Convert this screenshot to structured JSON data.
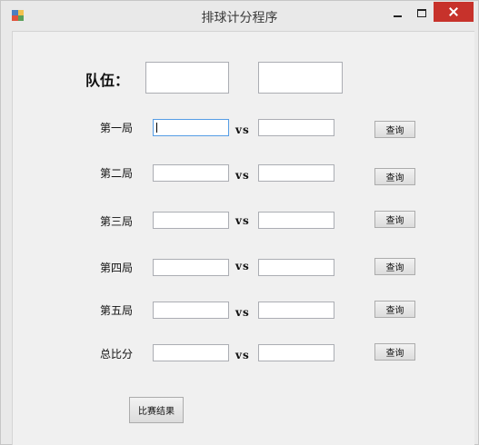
{
  "window": {
    "title": "排球计分程序"
  },
  "teams": {
    "label": "队伍：",
    "team_a": "",
    "team_b": ""
  },
  "rounds": [
    {
      "label": "第一局",
      "a": "",
      "b": "",
      "vs": "vs",
      "query": "查询"
    },
    {
      "label": "第二局",
      "a": "",
      "b": "",
      "vs": "vs",
      "query": "查询"
    },
    {
      "label": "第三局",
      "a": "",
      "b": "",
      "vs": "vs",
      "query": "查询"
    },
    {
      "label": "第四局",
      "a": "",
      "b": "",
      "vs": "vs",
      "query": "查询"
    },
    {
      "label": "第五局",
      "a": "",
      "b": "",
      "vs": "vs",
      "query": "查询"
    }
  ],
  "total": {
    "label": "总比分",
    "a": "",
    "b": "",
    "vs": "vs",
    "query": "查询"
  },
  "result_button": "比赛结果",
  "colors": {
    "close_button": "#c7322b",
    "focus_border": "#569de5"
  }
}
